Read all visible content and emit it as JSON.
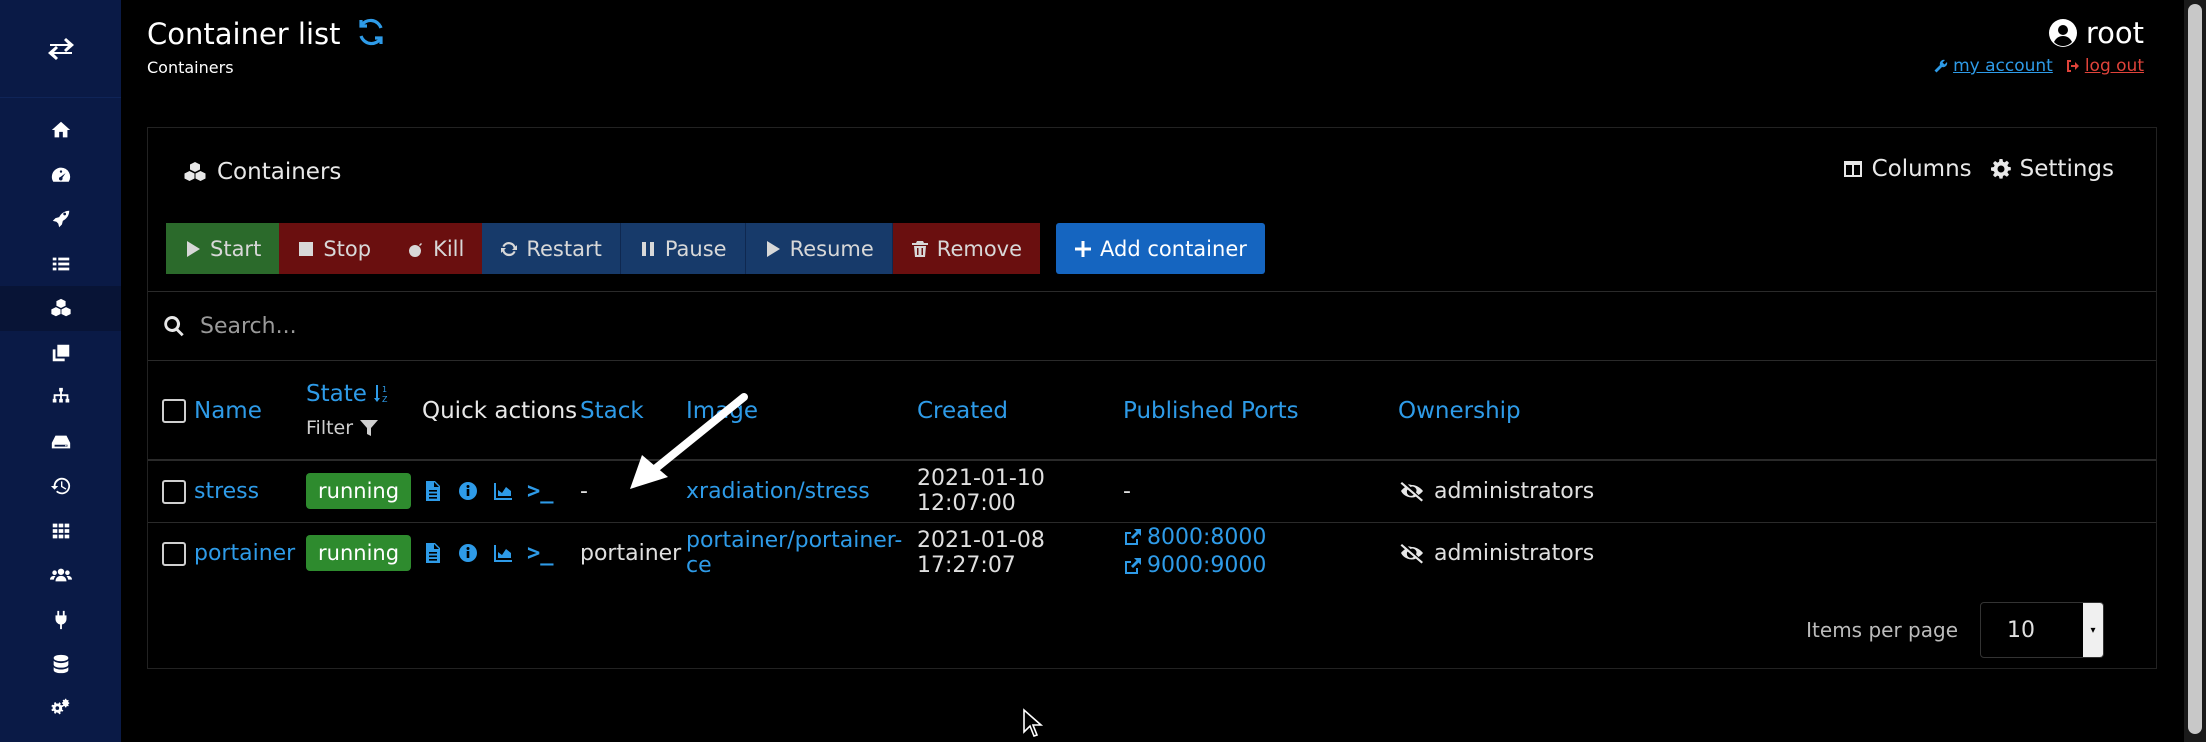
{
  "header": {
    "title": "Container list",
    "subtitle": "Containers",
    "user": "root",
    "my_account": "my account",
    "log_out": "log out"
  },
  "sidebar": {
    "top_icon": "exchange-icon",
    "items": [
      {
        "icon": "home-icon"
      },
      {
        "icon": "dashboard-icon"
      },
      {
        "icon": "rocket-icon"
      },
      {
        "icon": "list-icon"
      },
      {
        "icon": "cubes-icon",
        "active": true
      },
      {
        "icon": "clone-icon"
      },
      {
        "icon": "sitemap-icon"
      },
      {
        "icon": "hdd-icon"
      },
      {
        "icon": "history-icon"
      },
      {
        "icon": "th-icon"
      },
      {
        "icon": "users-icon"
      },
      {
        "icon": "plug-icon"
      },
      {
        "icon": "database-icon"
      },
      {
        "icon": "cogs-icon"
      }
    ]
  },
  "panel": {
    "title": "Containers",
    "columns_label": "Columns",
    "settings_label": "Settings"
  },
  "toolbar": {
    "start": "Start",
    "stop": "Stop",
    "kill": "Kill",
    "restart": "Restart",
    "pause": "Pause",
    "resume": "Resume",
    "remove": "Remove",
    "add": "Add container"
  },
  "search": {
    "placeholder": "Search..."
  },
  "table": {
    "headers": {
      "name": "Name",
      "state": "State",
      "filter": "Filter",
      "quick_actions": "Quick actions",
      "stack": "Stack",
      "image": "Image",
      "created": "Created",
      "ports": "Published Ports",
      "ownership": "Ownership"
    },
    "rows": [
      {
        "name": "stress",
        "state": "running",
        "stack": "-",
        "image": "xradiation/stress",
        "created": "2021-01-10 12:07:00",
        "ports": [
          "-"
        ],
        "ownership": "administrators"
      },
      {
        "name": "portainer",
        "state": "running",
        "stack": "portainer",
        "image": "portainer/portainer-ce",
        "created": "2021-01-08 17:27:07",
        "ports": [
          "8000:8000",
          "9000:9000"
        ],
        "ownership": "administrators"
      }
    ]
  },
  "pagination": {
    "items_per_page_label": "Items per page",
    "items_per_page": "10"
  },
  "colors": {
    "sidebar": "#0a1a46",
    "link": "#2e9be8",
    "running": "#2e8b2e",
    "start": "#2b6a2b",
    "danger": "#6a0f0f",
    "neutral": "#173a6a",
    "primary": "#1565c0",
    "logout": "#e0433a"
  }
}
